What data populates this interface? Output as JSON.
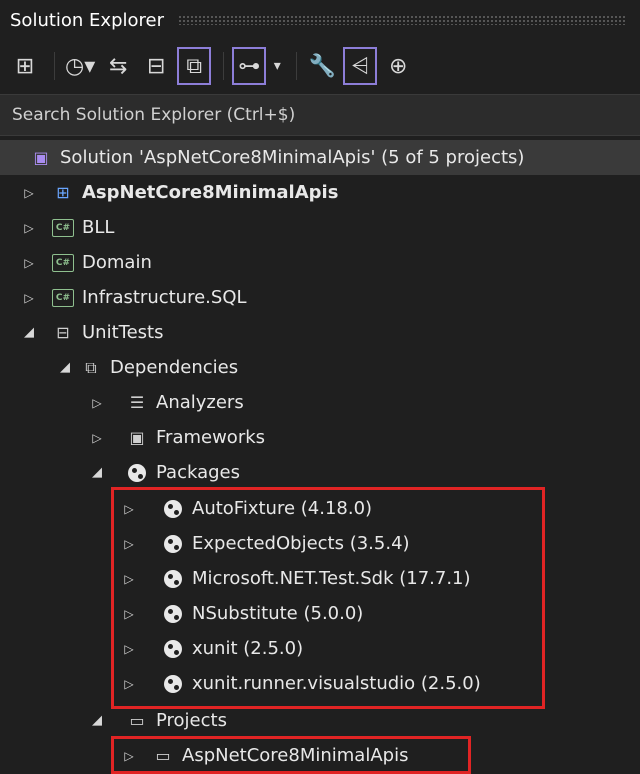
{
  "window": {
    "title": "Solution Explorer"
  },
  "toolbar": {
    "items": [
      {
        "icon": "switch-views-icon"
      },
      {
        "icon": "pending-changes-icon"
      },
      {
        "icon": "sync-icon"
      },
      {
        "icon": "collapse-all-icon"
      },
      {
        "icon": "show-all-files-icon"
      },
      {
        "icon": "preview-selected-icon"
      },
      {
        "icon": "properties-icon"
      },
      {
        "icon": "file-nesting-icon"
      },
      {
        "icon": "class-view-icon"
      }
    ]
  },
  "search": {
    "placeholder": "Search Solution Explorer (Ctrl+$)"
  },
  "tree": {
    "solution": "Solution 'AspNetCore8MinimalApis' (5 of 5 projects)",
    "projects": [
      "AspNetCore8MinimalApis",
      "BLL",
      "Domain",
      "Infrastructure.SQL",
      "UnitTests"
    ],
    "dependencies": "Dependencies",
    "dep_items": [
      "Analyzers",
      "Frameworks",
      "Packages"
    ],
    "packages": [
      "AutoFixture (4.18.0)",
      "ExpectedObjects (3.5.4)",
      "Microsoft.NET.Test.Sdk (17.7.1)",
      "NSubstitute (5.0.0)",
      "xunit (2.5.0)",
      "xunit.runner.visualstudio (2.5.0)"
    ],
    "projects_node": "Projects",
    "project_refs": [
      "AspNetCore8MinimalApis"
    ]
  },
  "colors": {
    "highlight_box": "#e02424",
    "accent": "#8d7ed8"
  }
}
